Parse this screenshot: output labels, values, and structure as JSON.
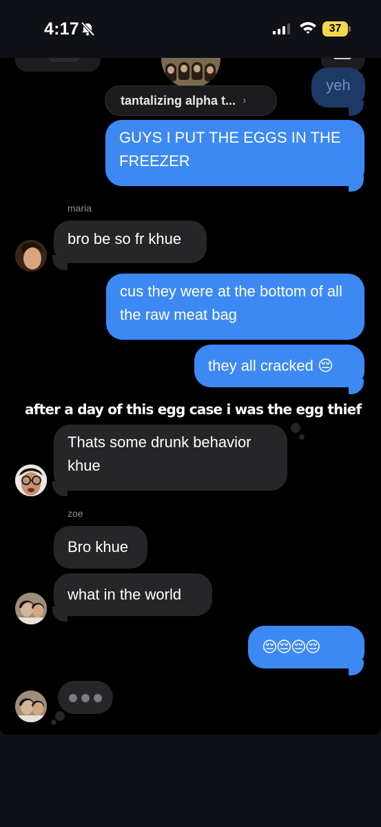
{
  "status_bar": {
    "time": "4:17",
    "battery": "37"
  },
  "header": {
    "group_name": "tantalizing alpha t...",
    "chevron": "›"
  },
  "messages": [
    {
      "text": "yeh"
    },
    {
      "text": "GUYS I PUT THE EGGS IN THE FREEZER"
    },
    {
      "sender": "maria"
    },
    {
      "text": "bro be so fr khue"
    },
    {
      "text": "cus they were at the bottom of all the raw meat bag"
    },
    {
      "text": "they all cracked 😔"
    },
    {
      "text": "Thats some drunk behavior khue"
    },
    {
      "sender": "zoe"
    },
    {
      "text": "Bro khue"
    },
    {
      "text": "what in the world"
    },
    {
      "text": "😔😔😔😔"
    }
  ],
  "caption": "after a day of this egg case i was the egg thief",
  "colors": {
    "outgoing": "#3d89f4",
    "incoming": "#262629",
    "background": "#000000"
  }
}
